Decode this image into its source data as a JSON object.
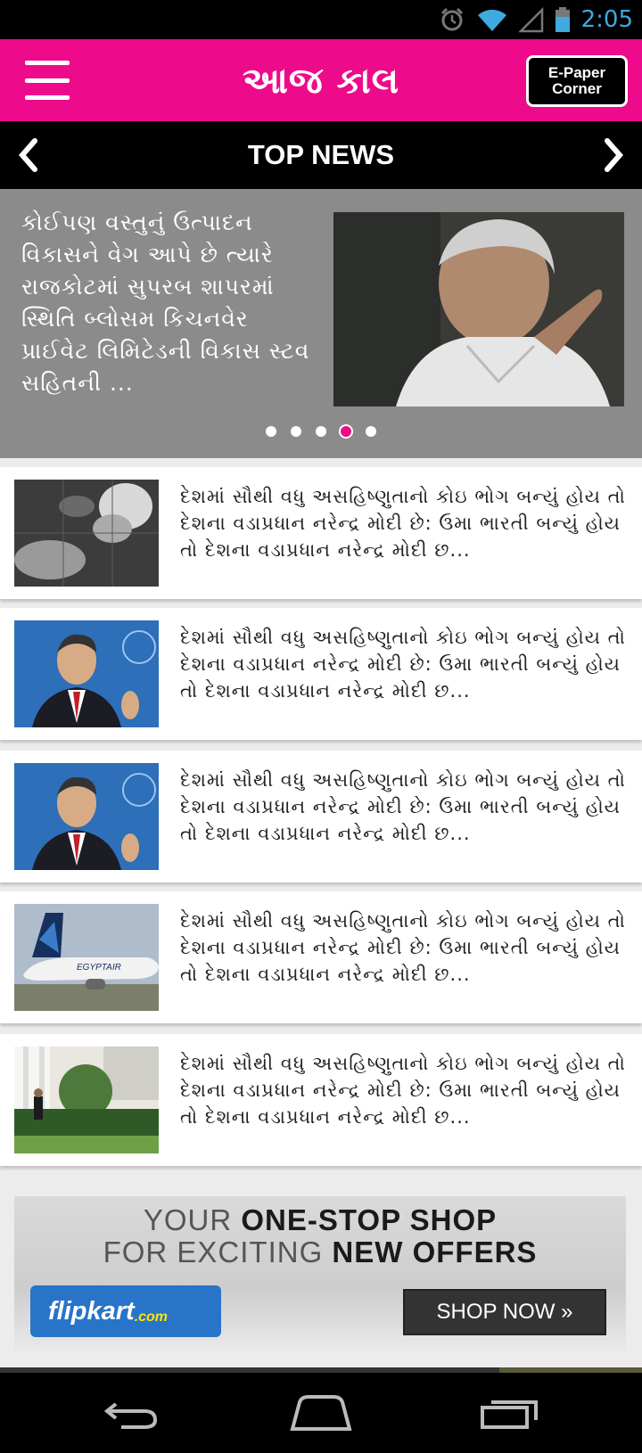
{
  "status_bar": {
    "time": "2:05"
  },
  "header": {
    "logo_text": "આજ કાલ",
    "epaper_line1": "E-Paper",
    "epaper_line2": "Corner"
  },
  "section": {
    "title": "TOP NEWS"
  },
  "featured": {
    "headline": "કોઈપણ વસ્તુનું ઉત્પાદન વિકાસને વેગ આપે છે ત્યારે રાજકોટમાં સુપરબ શાપરમાં સ્થિતિ બ્લોસમ કિચનવેર પ્રાઈવેટ લિમિટેડની વિકાસ સ્ટવ સહિતની ...",
    "slide_count": 5,
    "active_slide": 4
  },
  "news": [
    {
      "headline": "દેશમાં સૌથી વધુ અસહિષ્ણુતાનો કોઇ ભોગ બન્યું હોય તો દેશના વડાપ્રધાન નરેન્દ્ર મોદી છે: ઉમા ભારતી બન્યું હોય તો દેશના વડાપ્રધાન નરેન્દ્ર મોદી છ...",
      "thumb": "satellite-weather"
    },
    {
      "headline": "દેશમાં સૌથી વધુ અસહિષ્ણુતાનો કોઇ ભોગ બન્યું હોય તો દેશના વડાપ્રધાન નરેન્દ્ર મોદી છે: ઉમા ભારતી બન્યું હોય તો દેશના વડાપ્રધાન નરેન્દ્ર મોદી છ...",
      "thumb": "man-in-suit"
    },
    {
      "headline": "દેશમાં સૌથી વધુ અસહિષ્ણુતાનો કોઇ ભોગ બન્યું હોય તો દેશના વડાપ્રધાન નરેન્દ્ર મોદી છે: ઉમા ભારતી બન્યું હોય તો દેશના વડાપ્રધાન નરેન્દ્ર મોદી છ...",
      "thumb": "man-in-suit"
    },
    {
      "headline": "દેશમાં સૌથી વધુ અસહિષ્ણુતાનો કોઇ ભોગ બન્યું હોય તો દેશના વડાપ્રધાન નરેન્દ્ર મોદી છે: ઉમા ભારતી બન્યું હોય તો દેશના વડાપ્રધાન નરેન્દ્ર મોદી છ...",
      "thumb": "airplane"
    },
    {
      "headline": "દેશમાં સૌથી વધુ અસહિષ્ણુતાનો કોઇ ભોગ બન્યું હોય તો દેશના વડાપ્રધાન નરેન્દ્ર મોદી છે: ઉમા ભારતી બન્યું હોય તો દેશના વડાપ્રધાન નરેન્દ્ર મોદી છ...",
      "thumb": "garden-building"
    }
  ],
  "ad": {
    "line1_light": "YOUR ",
    "line1_bold": "ONE-STOP SHOP",
    "line2_light": "FOR EXCITING ",
    "line2_bold": "NEW OFFERS",
    "brand": "flipkart",
    "brand_suffix": ".com",
    "cta": "SHOP NOW »"
  },
  "colors": {
    "brand": "#ee0b8b",
    "carousel_bg": "#8b8b8b"
  },
  "icons": [
    "alarm-icon",
    "wifi-icon",
    "signal-icon",
    "battery-icon",
    "menu-icon",
    "chevron-left-icon",
    "chevron-right-icon",
    "back-icon",
    "home-icon",
    "recents-icon"
  ]
}
